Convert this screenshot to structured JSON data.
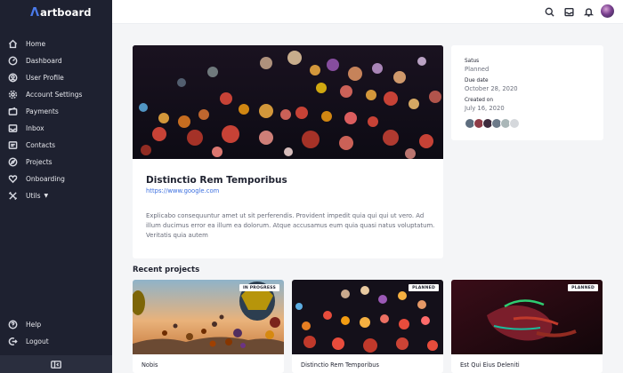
{
  "app": {
    "logo_text": "artboard"
  },
  "sidebar": {
    "items": [
      {
        "label": "Home",
        "icon": "home-icon"
      },
      {
        "label": "Dashboard",
        "icon": "dashboard-icon"
      },
      {
        "label": "User Profile",
        "icon": "user-icon"
      },
      {
        "label": "Account Settings",
        "icon": "gear-icon"
      },
      {
        "label": "Payments",
        "icon": "wallet-icon"
      },
      {
        "label": "Inbox",
        "icon": "inbox-icon"
      },
      {
        "label": "Contacts",
        "icon": "contacts-icon"
      },
      {
        "label": "Projects",
        "icon": "compass-icon"
      },
      {
        "label": "Onboarding",
        "icon": "heart-icon"
      },
      {
        "label": "Utils",
        "icon": "tools-icon"
      }
    ],
    "footer_items": [
      {
        "label": "Help",
        "icon": "help-icon"
      },
      {
        "label": "Logout",
        "icon": "logout-icon"
      }
    ]
  },
  "project": {
    "title": "Distinctio Rem Temporibus",
    "link": "https://www.google.com",
    "description": "Explicabo consequuntur amet ut sit perferendis. Provident impedit quia qui qui ut vero. Ad illum ducimus error ea illum ea dolorum. Atque accusamus eum quia quasi natus voluptatum. Veritatis quia autem",
    "status_label": "Satus",
    "status_value": "Planned",
    "due_label": "Due date",
    "due_value": "October 28, 2020",
    "created_label": "Created on",
    "created_value": "July 16, 2020"
  },
  "recent": {
    "title": "Recent projects",
    "cards": [
      {
        "name": "Nobis",
        "badge": "IN PROGRESS"
      },
      {
        "name": "Distinctio Rem Temporibus",
        "badge": "PLANNED"
      },
      {
        "name": "Est Qui Eius Deleniti",
        "badge": "PLANNED"
      }
    ]
  },
  "colors": {
    "sidebar_bg": "#1e2130",
    "accent": "#3b6fe0",
    "page_bg": "#f4f5f7"
  }
}
